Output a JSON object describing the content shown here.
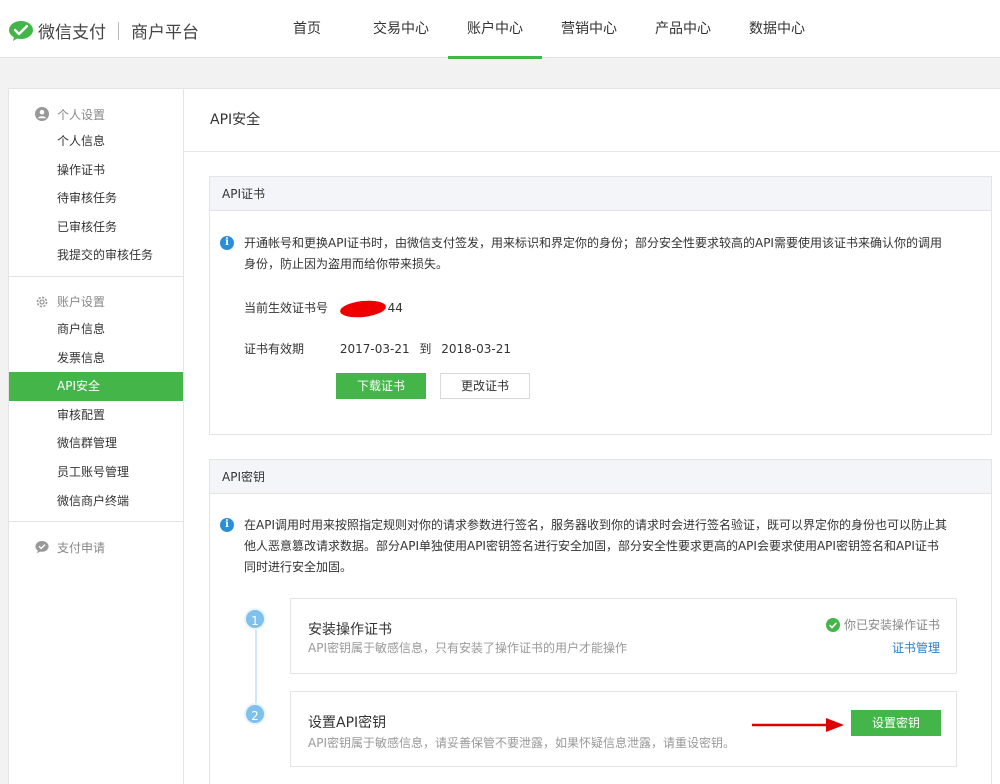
{
  "header": {
    "brand": "微信支付",
    "sub_brand": "商户平台",
    "nav": [
      "首页",
      "交易中心",
      "账户中心",
      "营销中心",
      "产品中心",
      "数据中心"
    ],
    "active_nav_index": 2
  },
  "sidebar": {
    "groups": [
      {
        "title": "个人设置",
        "icon": "user-circle-icon",
        "items": [
          "个人信息",
          "操作证书",
          "待审核任务",
          "已审核任务",
          "我提交的审核任务"
        ]
      },
      {
        "title": "账户设置",
        "icon": "gear-icon",
        "items": [
          "商户信息",
          "发票信息",
          "API安全",
          "审核配置",
          "微信群管理",
          "员工账号管理",
          "微信商户终端"
        ]
      },
      {
        "title": "支付申请",
        "icon": "chat-bubble-icon",
        "items": []
      }
    ],
    "active_item": "API安全"
  },
  "main": {
    "page_title": "API安全",
    "cert_card": {
      "title": "API证书",
      "info_line1": "开通帐号和更换API证书时，由微信支付签发，用来标识和界定你的身份；部分安全性要求较高的API需要使用该证书来确认你的调用",
      "info_line2": "身份，防止因为盗用而给你带来损失。",
      "serial_label": "当前生效证书号",
      "serial_suffix": "44",
      "validity_label": "证书有效期",
      "validity_from": "2017-03-21",
      "validity_to_word": "到",
      "validity_to": "2018-03-21",
      "download_button": "下载证书",
      "change_button": "更改证书"
    },
    "key_card": {
      "title": "API密钥",
      "info_line1": "在API调用时用来按照指定规则对你的请求参数进行签名，服务器收到你的请求时会进行签名验证，既可以界定你的身份也可以防止其",
      "info_line2": "他人恶意篡改请求数据。部分API单独使用API密钥签名进行安全加固，部分安全性要求更高的API会要求使用API密钥签名和API证书",
      "info_line3": "同时进行安全加固。",
      "steps": [
        {
          "number": "1",
          "title": "安装操作证书",
          "desc": "API密钥属于敏感信息，只有安装了操作证书的用户才能操作",
          "status": "你已安装操作证书",
          "link": "证书管理"
        },
        {
          "number": "2",
          "title": "设置API密钥",
          "desc": "API密钥属于敏感信息，请妥善保管不要泄露，如果怀疑信息泄露，请重设密钥。",
          "button": "设置密钥"
        }
      ]
    }
  },
  "colors": {
    "accent": "#44b549",
    "info_blue": "#2d8ed8",
    "annotation_red": "#e00000"
  }
}
